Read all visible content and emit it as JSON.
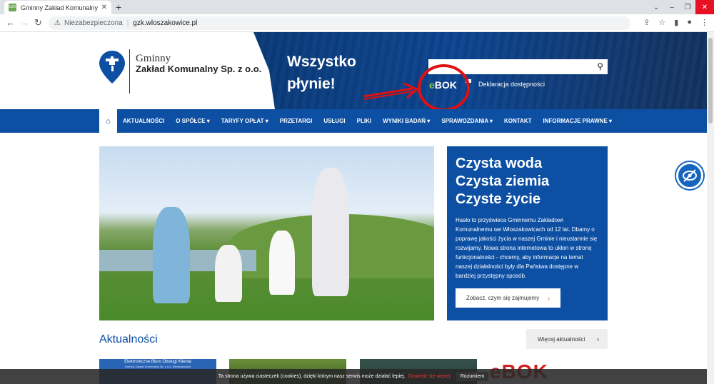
{
  "browser": {
    "tab_title": "Gminny Zakład Komunalny Włoszakowice",
    "tab_favicon": "GZK",
    "security_label": "Niezabezpieczona",
    "url": "gzk.wloszakowice.pl"
  },
  "header": {
    "logo_line1": "Gminny",
    "logo_line2": "Zakład Komunalny Sp. z o.o.",
    "slogan": "Wszystko płynie!",
    "search_placeholder": "",
    "ebok_e": "e",
    "ebok_rest": "BOK",
    "declaration_link": "Deklaracja dostępności"
  },
  "menu": {
    "home_icon": "home-icon",
    "items": [
      "AKTUALNOŚCI",
      "O SPÓŁCE ▾",
      "TARYFY OPŁAT ▾",
      "PRZETARGI",
      "USŁUGI",
      "PLIKI",
      "WYNIKI BADAŃ ▾",
      "SPRAWOZDANIA ▾",
      "KONTAKT",
      "INFORMACJE PRAWNE ▾"
    ]
  },
  "hero": {
    "heading_1": "Czysta woda",
    "heading_2": "Czysta ziemia",
    "heading_3": "Czyste życie",
    "text": "Hasło to przyświeca Gminnemu Zakładowi Komunalnemu we Włoszakowicach od 12 lat. Dbamy o poprawę jakości życia w naszej Gminie i nieustannie się rozwijamy. Nowa strona internetowa to ukłon w stronę funkcjonalności - chcemy, aby informacje na temat naszej działalności były dla Państwa dostępne w bardziej przystępny sposób.",
    "button_label": "Zobacz, czym się zajmujemy"
  },
  "news": {
    "title": "Aktualności",
    "more_button": "Więcej aktualności",
    "thumb1_line1": "Elektroniczne Biuro Obsługi Klienta",
    "thumb1_line2": "Gminny Zakład Komunalny Sp. z o.o. Włoszakowice",
    "thumb4_text": "eBOK"
  },
  "cookie": {
    "text": "Ta strona używa ciasteczek (cookies), dzięki którym nasz serwis może działać lepiej.",
    "more_link": "Dowiedz się więcej",
    "accept": "Rozumiem"
  },
  "colors": {
    "brand_blue": "#0c4fa3",
    "header_dark": "#0a3a78",
    "annotation_red": "#e01010",
    "ebok_green": "#8bc34a"
  }
}
